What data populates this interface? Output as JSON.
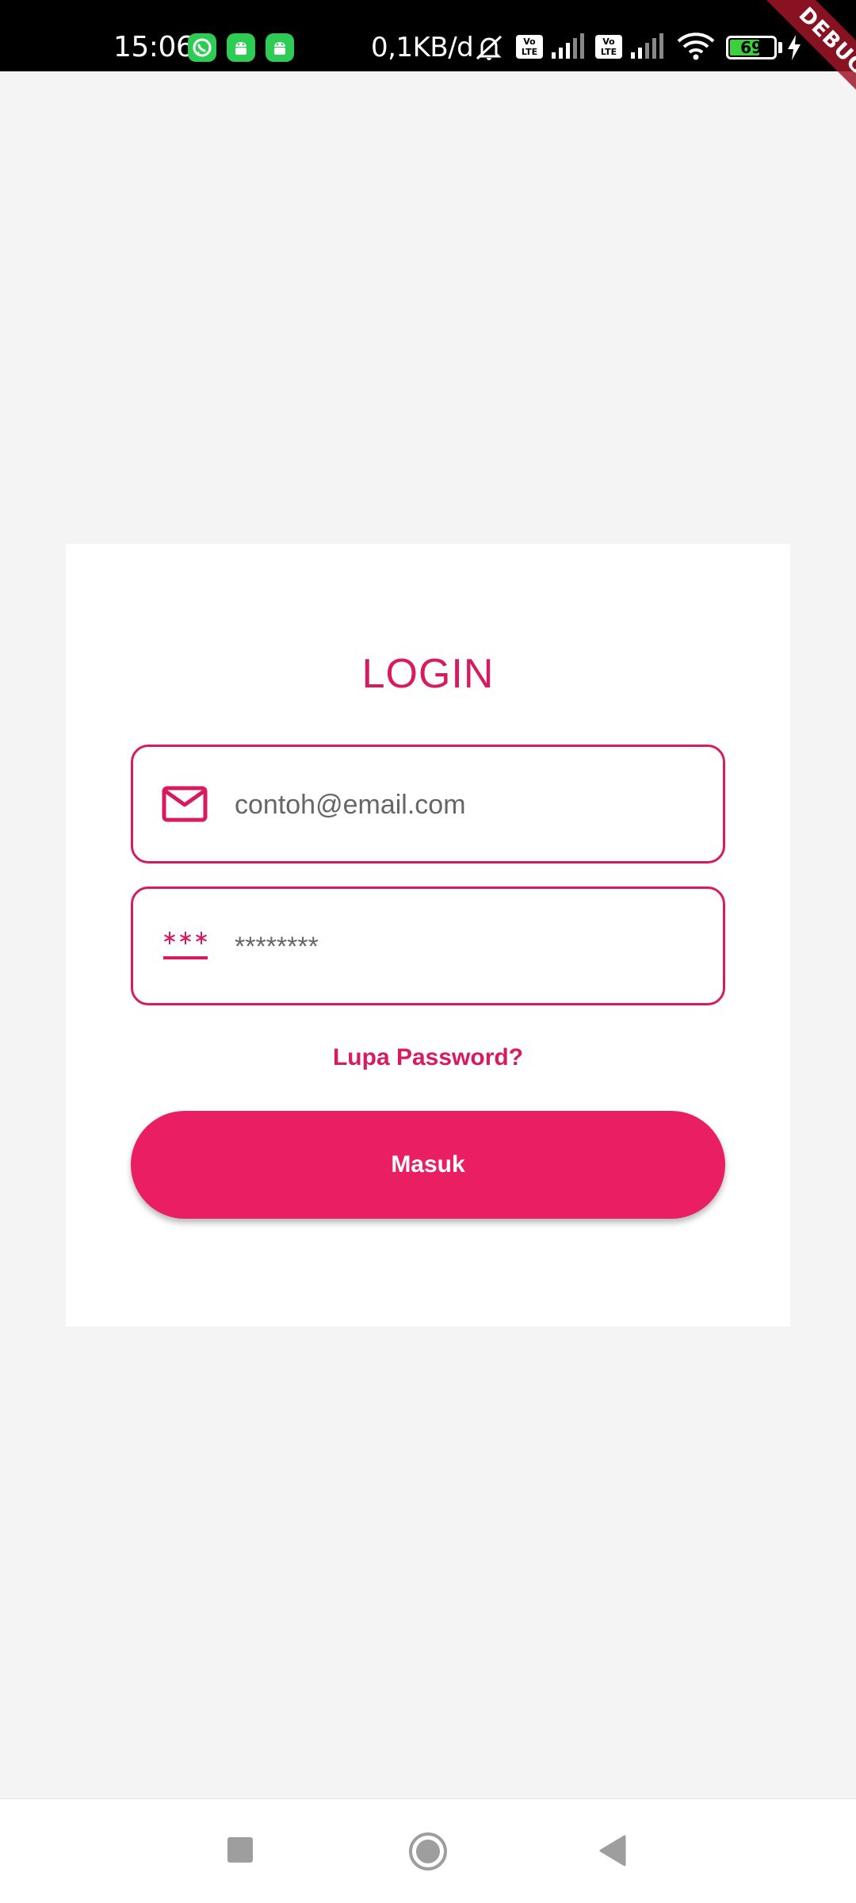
{
  "status_bar": {
    "time": "15:06",
    "network_speed": "0,1KB/d",
    "volte_label": "Vo LTE",
    "battery_level": "69",
    "battery_fraction": 0.69,
    "icons": [
      "whatsapp-icon",
      "android-icon",
      "android-icon",
      "mute-icon",
      "volte-icon",
      "signal-icon",
      "volte-icon",
      "signal-icon",
      "wifi-icon",
      "battery-icon",
      "charging-icon"
    ]
  },
  "debug_banner": "DEBUG",
  "login": {
    "title": "LOGIN",
    "email_placeholder": "contoh@email.com",
    "password_placeholder": "********",
    "forgot_password": "Lupa Password?",
    "submit_label": "Masuk"
  },
  "nav": {
    "buttons": [
      "recents-button",
      "home-button",
      "back-button"
    ]
  },
  "colors": {
    "accent": "#d81b60",
    "button": "#e91e63",
    "background": "#f4f4f4",
    "card": "#ffffff"
  }
}
